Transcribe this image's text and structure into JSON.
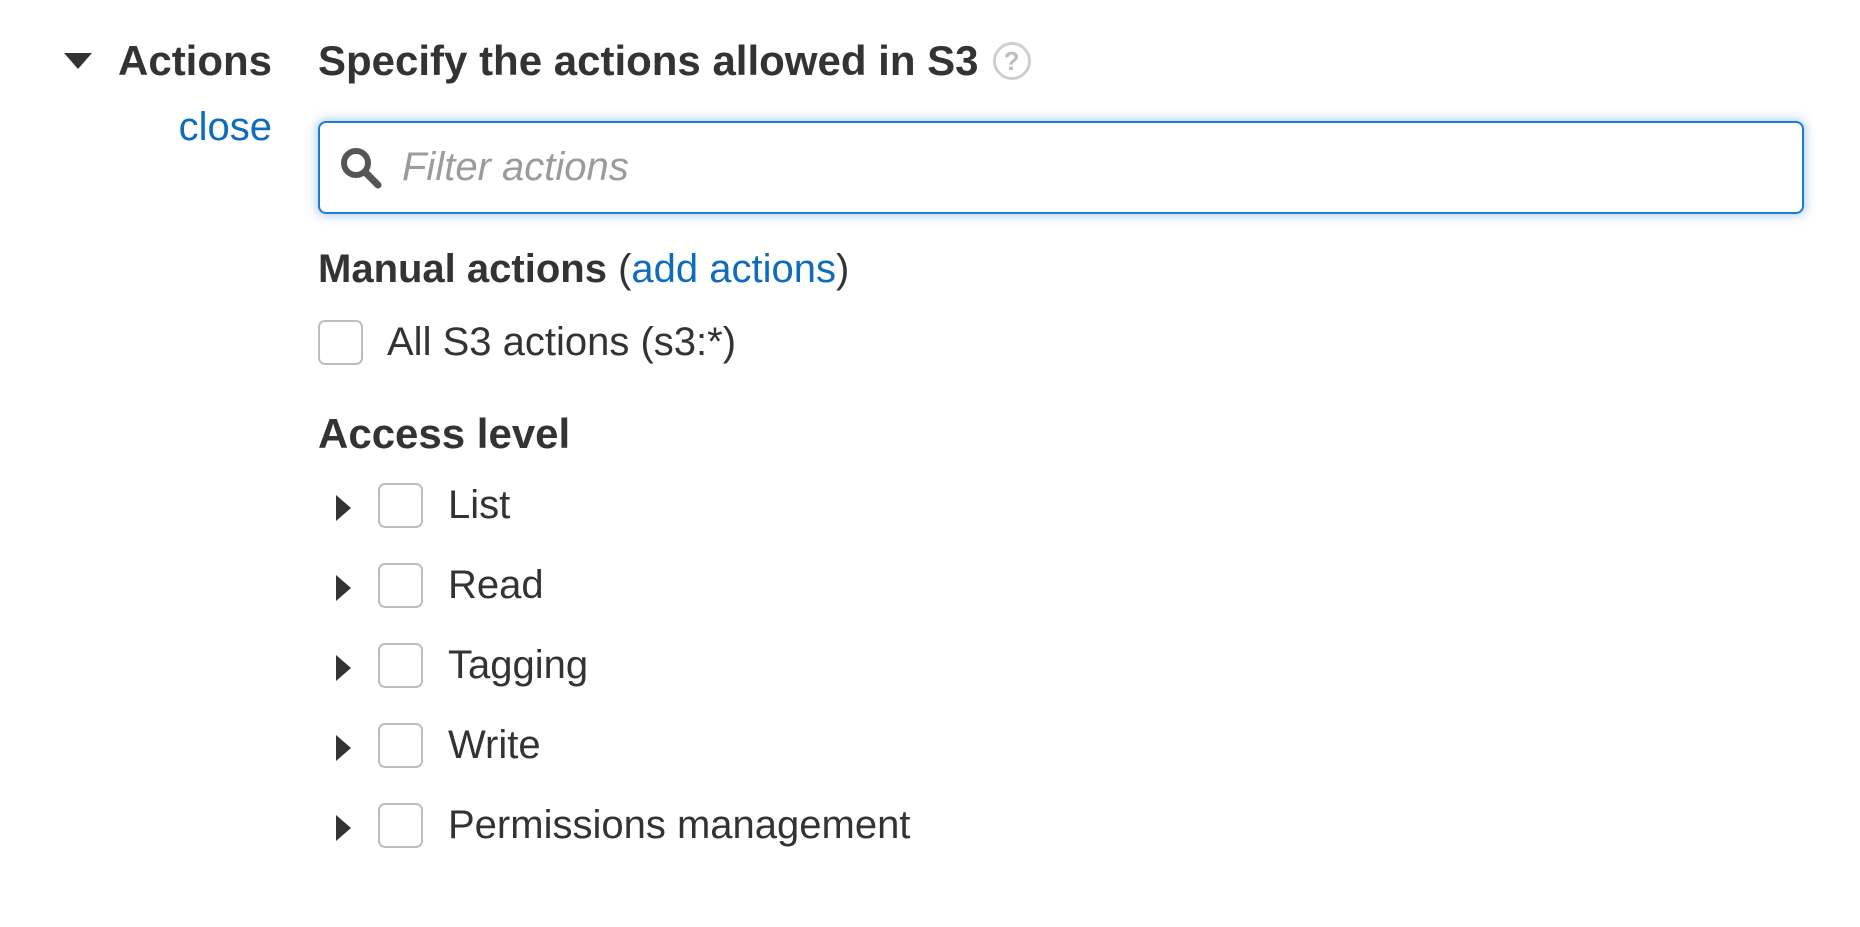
{
  "section": {
    "title": "Actions",
    "close_label": "close",
    "caret_icon": "caret-down-icon"
  },
  "spec": {
    "title": "Specify the actions allowed in S3",
    "help_glyph": "?"
  },
  "filter": {
    "placeholder": "Filter actions",
    "value": "",
    "icon": "search-icon",
    "border_color": "#1f7ad6"
  },
  "manual": {
    "title": "Manual actions",
    "open_paren": "(",
    "add_link": "add actions",
    "close_paren": ")"
  },
  "all_actions": {
    "label": "All S3 actions (s3:*)",
    "checked": false
  },
  "access_level": {
    "title": "Access level",
    "items": [
      {
        "label": "List",
        "checked": false
      },
      {
        "label": "Read",
        "checked": false
      },
      {
        "label": "Tagging",
        "checked": false
      },
      {
        "label": "Write",
        "checked": false
      },
      {
        "label": "Permissions management",
        "checked": false
      }
    ]
  },
  "colors": {
    "link": "#0f6cbd",
    "text": "#333333",
    "checkbox_border": "#bdbdbd"
  }
}
